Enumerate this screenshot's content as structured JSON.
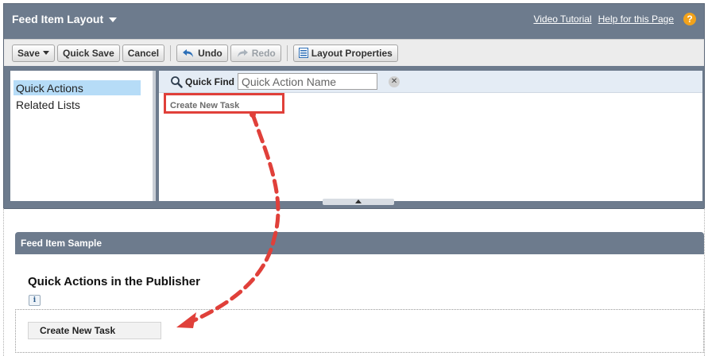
{
  "editor": {
    "title": "Feed Item Layout",
    "links": {
      "video_tutorial": "Video Tutorial",
      "help": "Help for this Page"
    }
  },
  "toolbar": {
    "save": "Save",
    "quick_save": "Quick Save",
    "cancel": "Cancel",
    "undo": "Undo",
    "redo": "Redo",
    "layout_properties": "Layout Properties"
  },
  "palette": {
    "categories": [
      "Quick Actions",
      "Related Lists"
    ],
    "selected_category": "Quick Actions",
    "quick_find_label": "Quick Find",
    "quick_find_placeholder": "Quick Action Name",
    "items": [
      "Create New Task"
    ]
  },
  "sample": {
    "header": "Feed Item Sample",
    "section_title": "Quick Actions in the Publisher",
    "info_glyph": "i",
    "publisher_actions": [
      "Create New Task"
    ]
  },
  "colors": {
    "header_bar": "#6d7b8d",
    "selected_category": "#b6dcf7",
    "annotation_red": "#e0403a",
    "help_orange": "#f2a21b"
  },
  "icons": {
    "help": "help-circle-icon",
    "undo": "undo-arrow-icon",
    "redo": "redo-arrow-icon",
    "layout_properties": "properties-icon",
    "search": "magnifier-icon",
    "clear": "clear-x-icon",
    "info": "info-icon"
  }
}
